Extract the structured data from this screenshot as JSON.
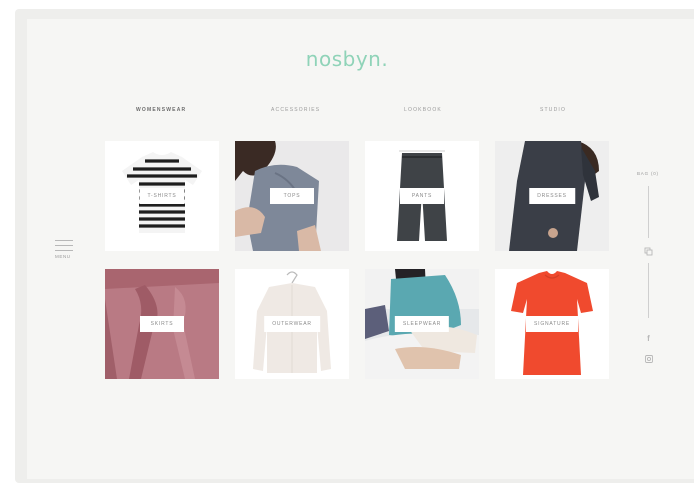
{
  "brand": {
    "logo": "nosbyn.",
    "accent": "#8fd3b8"
  },
  "nav": [
    {
      "label": "WOMENSWEAR",
      "active": true
    },
    {
      "label": "ACCESSORIES",
      "active": false
    },
    {
      "label": "LOOKBOOK",
      "active": false
    },
    {
      "label": "STUDIO",
      "active": false
    }
  ],
  "menu": {
    "label": "MENU",
    "icon": "hamburger-icon"
  },
  "categories": [
    {
      "label": "T-SHIRTS"
    },
    {
      "label": "TOPS"
    },
    {
      "label": "PANTS"
    },
    {
      "label": "DRESSES"
    },
    {
      "label": "SKIRTS"
    },
    {
      "label": "OUTERWEAR"
    },
    {
      "label": "SLEEPWEAR"
    },
    {
      "label": "SIGNATURE"
    }
  ],
  "sidebar": {
    "bag_label": "BAG (0)",
    "icons": [
      "dice-icon",
      "facebook-icon",
      "instagram-icon"
    ],
    "facebook_glyph": "f"
  }
}
